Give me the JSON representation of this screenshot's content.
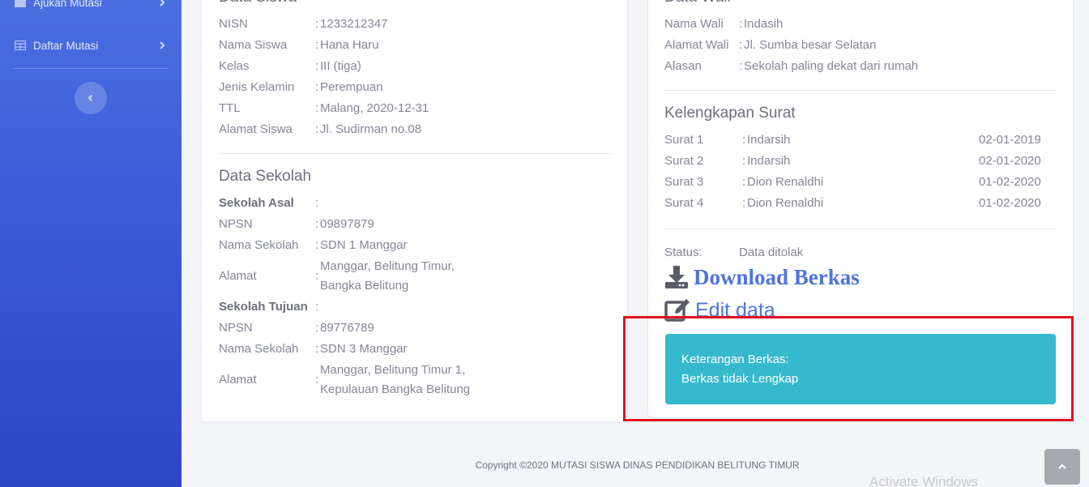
{
  "sidebar": {
    "items": [
      {
        "label": "Ajukan Mutasi",
        "icon": "list-icon"
      },
      {
        "label": "Daftar Mutasi",
        "icon": "table-icon"
      }
    ],
    "toggle_icon": "chevron-left-icon"
  },
  "data_siswa": {
    "title": "Data Siswa",
    "rows": [
      {
        "key": "NISN",
        "value": "1233212347"
      },
      {
        "key": "Nama Siswa",
        "value": "Hana Haru"
      },
      {
        "key": "Kelas",
        "value": "III (tiga)"
      },
      {
        "key": "Jenis Kelamin",
        "value": "Perempuan"
      },
      {
        "key": "TTL",
        "value": "Malang, 2020-12-31"
      },
      {
        "key": "Alamat Siswa",
        "value": "Jl. Sudirman no.08"
      }
    ]
  },
  "data_sekolah": {
    "title": "Data Sekolah",
    "asal": {
      "heading": "Sekolah Asal",
      "npsn_label": "NPSN",
      "npsn": "09897879",
      "nama_label": "Nama Sekolah",
      "nama": "SDN 1 Manggar",
      "alamat_label": "Alamat",
      "alamat_1": "Manggar, Belitung Timur,",
      "alamat_2": "Bangka Belitung"
    },
    "tujuan": {
      "heading": "Sekolah Tujuan",
      "npsn_label": "NPSN",
      "npsn": "89776789",
      "nama_label": "Nama Sekolah",
      "nama": "SDN 3 Manggar",
      "alamat_label": "Alamat",
      "alamat_1": "Manggar, Belitung Timur 1,",
      "alamat_2": "Kepulauan Bangka Belitung"
    }
  },
  "data_wali": {
    "title": "Data Wali",
    "rows": [
      {
        "key": "Nama Wali",
        "value": "Indasih"
      },
      {
        "key": "Alamat Wali",
        "value": "Jl. Sumba besar Selatan"
      },
      {
        "key": "Alasan",
        "value": "Sekolah paling dekat dari rumah"
      }
    ]
  },
  "kelengkapan": {
    "title": "Kelengkapan Surat",
    "rows": [
      {
        "key": "Surat 1",
        "value": "Indarsih",
        "date": "02-01-2019"
      },
      {
        "key": "Surat 2",
        "value": "Indarsih",
        "date": "02-01-2020"
      },
      {
        "key": "Surat 3",
        "value": "Dion Renaldhi",
        "date": "01-02-2020"
      },
      {
        "key": "Surat 4",
        "value": "Dion Renaldhi",
        "date": "01-02-2020"
      }
    ]
  },
  "status": {
    "label": "Status:",
    "value": "Data ditolak"
  },
  "actions": {
    "download": "Download Berkas",
    "edit": "Edit data"
  },
  "keterangan": {
    "label": "Keterangan Berkas:",
    "text": "Berkas tidak Lengkap"
  },
  "footer": {
    "copyright": "Copyright ©2020 MUTASI SISWA DINAS PENDIDIKAN BELITUNG TIMUR"
  },
  "watermark": "Activate Windows",
  "colors": {
    "primary": "#4e73df",
    "info": "#36b9cc",
    "highlight": "#e0141e"
  }
}
